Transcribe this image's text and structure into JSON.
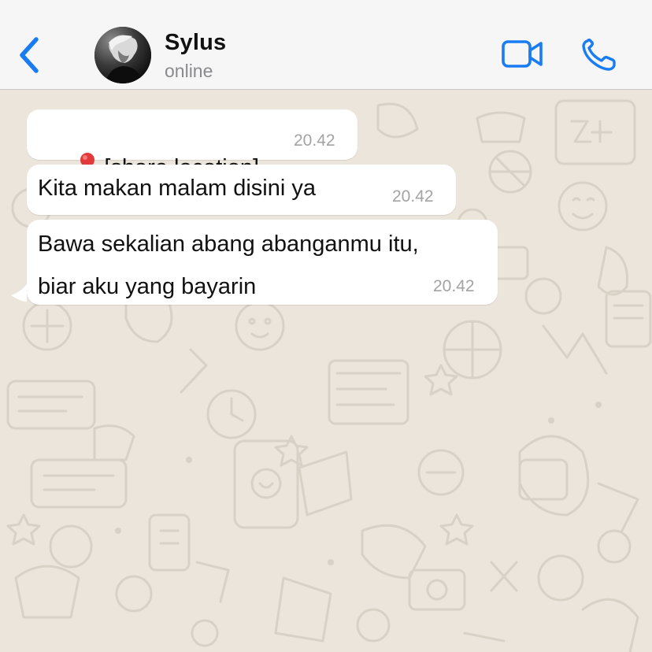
{
  "header": {
    "contact_name": "Sylus",
    "status": "online"
  },
  "colors": {
    "accent": "#1a7cf2",
    "header_bg": "#f6f6f6",
    "wallpaper_bg": "#ece5dc",
    "bubble_bg": "#ffffff",
    "timestamp": "#a3a3a3"
  },
  "icons": {
    "back": "chevron-left-icon",
    "video": "video-camera-icon",
    "call": "phone-icon",
    "pin": "pin-icon"
  },
  "messages": [
    {
      "text": "[share location]",
      "time": "20.42",
      "has_pin": true
    },
    {
      "text": "Kita makan malam disini ya",
      "time": "20.42",
      "has_pin": false
    },
    {
      "text": "Bawa sekalian abang abanganmu itu,\nbiar aku yang bayarin",
      "time": "20.42",
      "has_pin": false
    }
  ]
}
